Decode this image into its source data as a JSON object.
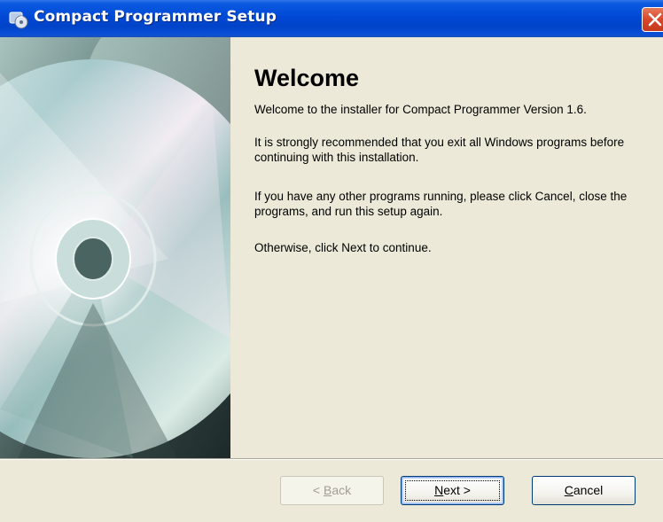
{
  "window": {
    "title": "Compact Programmer Setup",
    "icon": "installer-cd-icon",
    "close_icon": "close-icon"
  },
  "side_panel": {
    "image": "cd-disc-art"
  },
  "page": {
    "heading": "Welcome",
    "paragraphs": [
      "Welcome to the installer for Compact Programmer Version 1.6.",
      "It is strongly recommended that you exit all Windows programs before continuing with this installation.",
      "If you have any other programs running, please click Cancel, close the programs, and run this setup again.",
      "Otherwise, click Next to continue."
    ]
  },
  "buttons": {
    "back": {
      "prefix": "< ",
      "mnemonic": "B",
      "rest": "ack",
      "enabled": false
    },
    "next": {
      "mnemonic": "N",
      "rest": "ext >",
      "enabled": true,
      "default": true
    },
    "cancel": {
      "mnemonic": "C",
      "rest": "ancel",
      "enabled": true
    }
  },
  "colors": {
    "titlebar": "#0049D6",
    "dialog_bg": "#ECE9D8",
    "close_button": "#D9472B",
    "button_border": "#003C74"
  }
}
